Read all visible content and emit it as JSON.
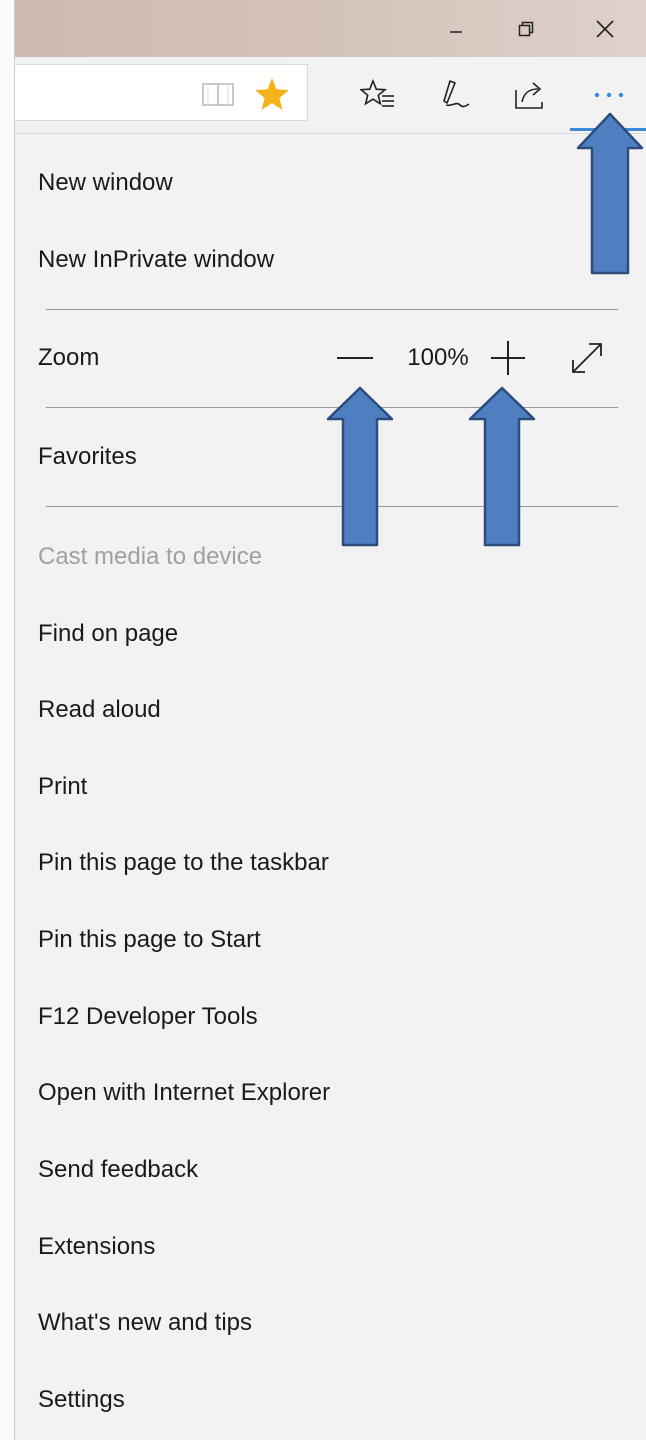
{
  "window_controls": {
    "minimize_icon": "minimize-icon",
    "restore_icon": "restore-icon",
    "close_icon": "close-icon"
  },
  "toolbar": {
    "reading_view_icon": "book-icon",
    "favorite_icon": "star-icon",
    "favorites_hub_icon": "favorites-list-icon",
    "notes_icon": "pen-icon",
    "share_icon": "share-icon",
    "more_icon": "ellipsis-icon",
    "star_color": "#f5b31b",
    "accent_color": "#3a8ad8"
  },
  "menu": {
    "new_window": "New window",
    "new_inprivate_window": "New InPrivate window",
    "zoom": {
      "label": "Zoom",
      "value": "100%"
    },
    "favorites": "Favorites",
    "cast_media": "Cast media to device",
    "find_on_page": "Find on page",
    "read_aloud": "Read aloud",
    "print": "Print",
    "pin_taskbar": "Pin this page to the taskbar",
    "pin_start": "Pin this page to Start",
    "developer_tools": "F12 Developer Tools",
    "open_ie": "Open with Internet Explorer",
    "send_feedback": "Send feedback",
    "extensions": "Extensions",
    "whats_new": "What's new and tips",
    "settings": "Settings"
  },
  "annotations": {
    "arrow_color": "#4f7fc0",
    "arrow_outline": "#2b4c7c"
  }
}
